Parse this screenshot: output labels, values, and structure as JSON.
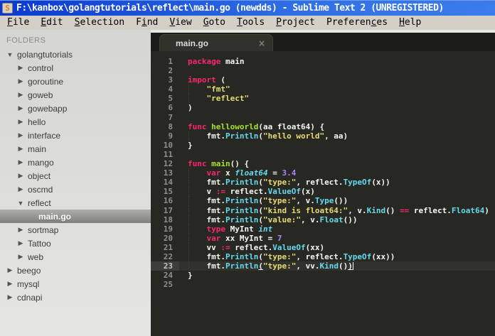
{
  "window": {
    "title": "F:\\kanbox\\golangtutorials\\reflect\\main.go (newdds) - Sublime Text 2 (UNREGISTERED)",
    "icon_letter": "S"
  },
  "menu": {
    "items": [
      {
        "label": "File",
        "mnemonic_index": 0
      },
      {
        "label": "Edit",
        "mnemonic_index": 0
      },
      {
        "label": "Selection",
        "mnemonic_index": 0
      },
      {
        "label": "Find",
        "mnemonic_index": 1
      },
      {
        "label": "View",
        "mnemonic_index": 0
      },
      {
        "label": "Goto",
        "mnemonic_index": 0
      },
      {
        "label": "Tools",
        "mnemonic_index": 0
      },
      {
        "label": "Project",
        "mnemonic_index": 0
      },
      {
        "label": "Preferences",
        "mnemonic_index": 8
      },
      {
        "label": "Help",
        "mnemonic_index": 0
      }
    ]
  },
  "sidebar": {
    "header": "FOLDERS",
    "items": [
      {
        "label": "golangtutorials",
        "level": 0,
        "type": "folder",
        "state": "expanded",
        "selected": false
      },
      {
        "label": "control",
        "level": 1,
        "type": "folder",
        "state": "collapsed",
        "selected": false
      },
      {
        "label": "goroutine",
        "level": 1,
        "type": "folder",
        "state": "collapsed",
        "selected": false
      },
      {
        "label": "goweb",
        "level": 1,
        "type": "folder",
        "state": "collapsed",
        "selected": false
      },
      {
        "label": "gowebapp",
        "level": 1,
        "type": "folder",
        "state": "collapsed",
        "selected": false
      },
      {
        "label": "hello",
        "level": 1,
        "type": "folder",
        "state": "collapsed",
        "selected": false
      },
      {
        "label": "interface",
        "level": 1,
        "type": "folder",
        "state": "collapsed",
        "selected": false
      },
      {
        "label": "main",
        "level": 1,
        "type": "folder",
        "state": "collapsed",
        "selected": false
      },
      {
        "label": "mango",
        "level": 1,
        "type": "folder",
        "state": "collapsed",
        "selected": false
      },
      {
        "label": "object",
        "level": 1,
        "type": "folder",
        "state": "collapsed",
        "selected": false
      },
      {
        "label": "oscmd",
        "level": 1,
        "type": "folder",
        "state": "collapsed",
        "selected": false
      },
      {
        "label": "reflect",
        "level": 1,
        "type": "folder",
        "state": "expanded",
        "selected": false
      },
      {
        "label": "main.go",
        "level": 2,
        "type": "file",
        "state": "none",
        "selected": true
      },
      {
        "label": "sortmap",
        "level": 1,
        "type": "folder",
        "state": "collapsed",
        "selected": false
      },
      {
        "label": "Tattoo",
        "level": 1,
        "type": "folder",
        "state": "collapsed",
        "selected": false
      },
      {
        "label": "web",
        "level": 1,
        "type": "folder",
        "state": "collapsed",
        "selected": false
      },
      {
        "label": "beego",
        "level": 0,
        "type": "folder",
        "state": "collapsed",
        "selected": false
      },
      {
        "label": "mysql",
        "level": 0,
        "type": "folder",
        "state": "collapsed",
        "selected": false
      },
      {
        "label": "cdnapi",
        "level": 0,
        "type": "folder",
        "state": "collapsed",
        "selected": false
      }
    ],
    "expanded_arrow": "▼",
    "collapsed_arrow": "▶"
  },
  "editor": {
    "tab": {
      "label": "main.go",
      "close_glyph": "×"
    },
    "current_line": 23,
    "colors": {
      "background": "#272822",
      "keyword": "#f92672",
      "function": "#a6e22e",
      "call": "#66d9ef",
      "type": "#66d9ef",
      "string": "#e6db74",
      "number": "#ae81ff",
      "plain": "#f8f8f2",
      "gutter": "#8f908a"
    },
    "lines": [
      {
        "n": 1,
        "ind": 0,
        "tokens": [
          [
            "k",
            "package"
          ],
          [
            "p",
            " main"
          ]
        ]
      },
      {
        "n": 2,
        "ind": 0,
        "tokens": []
      },
      {
        "n": 3,
        "ind": 0,
        "tokens": [
          [
            "k",
            "import"
          ],
          [
            "p",
            " ("
          ]
        ]
      },
      {
        "n": 4,
        "ind": 1,
        "tokens": [
          [
            "p",
            "    "
          ],
          [
            "s",
            "\"fmt\""
          ]
        ]
      },
      {
        "n": 5,
        "ind": 1,
        "tokens": [
          [
            "p",
            "    "
          ],
          [
            "s",
            "\"reflect\""
          ]
        ]
      },
      {
        "n": 6,
        "ind": 0,
        "tokens": [
          [
            "p",
            ")"
          ]
        ]
      },
      {
        "n": 7,
        "ind": 0,
        "tokens": []
      },
      {
        "n": 8,
        "ind": 0,
        "tokens": [
          [
            "k",
            "func"
          ],
          [
            "p",
            " "
          ],
          [
            "fn",
            "helloworld"
          ],
          [
            "p",
            "(aa float64) {"
          ]
        ]
      },
      {
        "n": 9,
        "ind": 1,
        "tokens": [
          [
            "p",
            "    fmt."
          ],
          [
            "c",
            "Println"
          ],
          [
            "p",
            "("
          ],
          [
            "s",
            "\"hello world\""
          ],
          [
            "p",
            ", aa)"
          ]
        ]
      },
      {
        "n": 10,
        "ind": 0,
        "tokens": [
          [
            "p",
            "}"
          ]
        ]
      },
      {
        "n": 11,
        "ind": 0,
        "tokens": []
      },
      {
        "n": 12,
        "ind": 0,
        "tokens": [
          [
            "k",
            "func"
          ],
          [
            "p",
            " "
          ],
          [
            "fn",
            "main"
          ],
          [
            "p",
            "() {"
          ]
        ]
      },
      {
        "n": 13,
        "ind": 1,
        "tokens": [
          [
            "p",
            "    "
          ],
          [
            "k",
            "var"
          ],
          [
            "p",
            " x "
          ],
          [
            "t",
            "float64"
          ],
          [
            "p",
            " = "
          ],
          [
            "n",
            "3.4"
          ]
        ]
      },
      {
        "n": 14,
        "ind": 1,
        "tokens": [
          [
            "p",
            "    fmt."
          ],
          [
            "c",
            "Println"
          ],
          [
            "p",
            "("
          ],
          [
            "s",
            "\"type:\""
          ],
          [
            "p",
            ", reflect."
          ],
          [
            "c",
            "TypeOf"
          ],
          [
            "p",
            "(x))"
          ]
        ]
      },
      {
        "n": 15,
        "ind": 1,
        "tokens": [
          [
            "p",
            "    v "
          ],
          [
            "k",
            ":="
          ],
          [
            "p",
            " reflect."
          ],
          [
            "c",
            "ValueOf"
          ],
          [
            "p",
            "(x)"
          ]
        ]
      },
      {
        "n": 16,
        "ind": 1,
        "tokens": [
          [
            "p",
            "    fmt."
          ],
          [
            "c",
            "Println"
          ],
          [
            "p",
            "("
          ],
          [
            "s",
            "\"type:\""
          ],
          [
            "p",
            ", v."
          ],
          [
            "c",
            "Type"
          ],
          [
            "p",
            "())"
          ]
        ]
      },
      {
        "n": 17,
        "ind": 1,
        "tokens": [
          [
            "p",
            "    fmt."
          ],
          [
            "c",
            "Println"
          ],
          [
            "p",
            "("
          ],
          [
            "s",
            "\"kind is float64:\""
          ],
          [
            "p",
            ", v."
          ],
          [
            "c",
            "Kind"
          ],
          [
            "p",
            "() "
          ],
          [
            "k",
            "=="
          ],
          [
            "p",
            " reflect."
          ],
          [
            "c",
            "Float64"
          ],
          [
            "p",
            ")"
          ]
        ]
      },
      {
        "n": 18,
        "ind": 1,
        "tokens": [
          [
            "p",
            "    fmt."
          ],
          [
            "c",
            "Println"
          ],
          [
            "p",
            "("
          ],
          [
            "s",
            "\"value:\""
          ],
          [
            "p",
            ", v."
          ],
          [
            "c",
            "Float"
          ],
          [
            "p",
            "())"
          ]
        ]
      },
      {
        "n": 19,
        "ind": 1,
        "tokens": [
          [
            "p",
            "    "
          ],
          [
            "k",
            "type"
          ],
          [
            "p",
            " MyInt "
          ],
          [
            "t",
            "int"
          ]
        ]
      },
      {
        "n": 20,
        "ind": 1,
        "tokens": [
          [
            "p",
            "    "
          ],
          [
            "k",
            "var"
          ],
          [
            "p",
            " xx MyInt = "
          ],
          [
            "n",
            "7"
          ]
        ]
      },
      {
        "n": 21,
        "ind": 1,
        "tokens": [
          [
            "p",
            "    vv "
          ],
          [
            "k",
            ":="
          ],
          [
            "p",
            " reflect."
          ],
          [
            "c",
            "ValueOf"
          ],
          [
            "p",
            "(xx)"
          ]
        ]
      },
      {
        "n": 22,
        "ind": 1,
        "tokens": [
          [
            "p",
            "    fmt."
          ],
          [
            "c",
            "Println"
          ],
          [
            "p",
            "("
          ],
          [
            "s",
            "\"type:\""
          ],
          [
            "p",
            ", reflect."
          ],
          [
            "c",
            "TypeOf"
          ],
          [
            "p",
            "(xx))"
          ]
        ]
      },
      {
        "n": 23,
        "ind": 1,
        "caret_at_end": true,
        "tokens": [
          [
            "p",
            "    fmt."
          ],
          [
            "c",
            "Println"
          ],
          [
            "pu",
            "("
          ],
          [
            "s",
            "\"type:\""
          ],
          [
            "p",
            ", vv."
          ],
          [
            "c",
            "Kind"
          ],
          [
            "p",
            "()"
          ],
          [
            "pu",
            ")"
          ]
        ]
      },
      {
        "n": 24,
        "ind": 0,
        "tokens": [
          [
            "p",
            "}"
          ]
        ]
      },
      {
        "n": 25,
        "ind": 0,
        "tokens": []
      }
    ]
  }
}
